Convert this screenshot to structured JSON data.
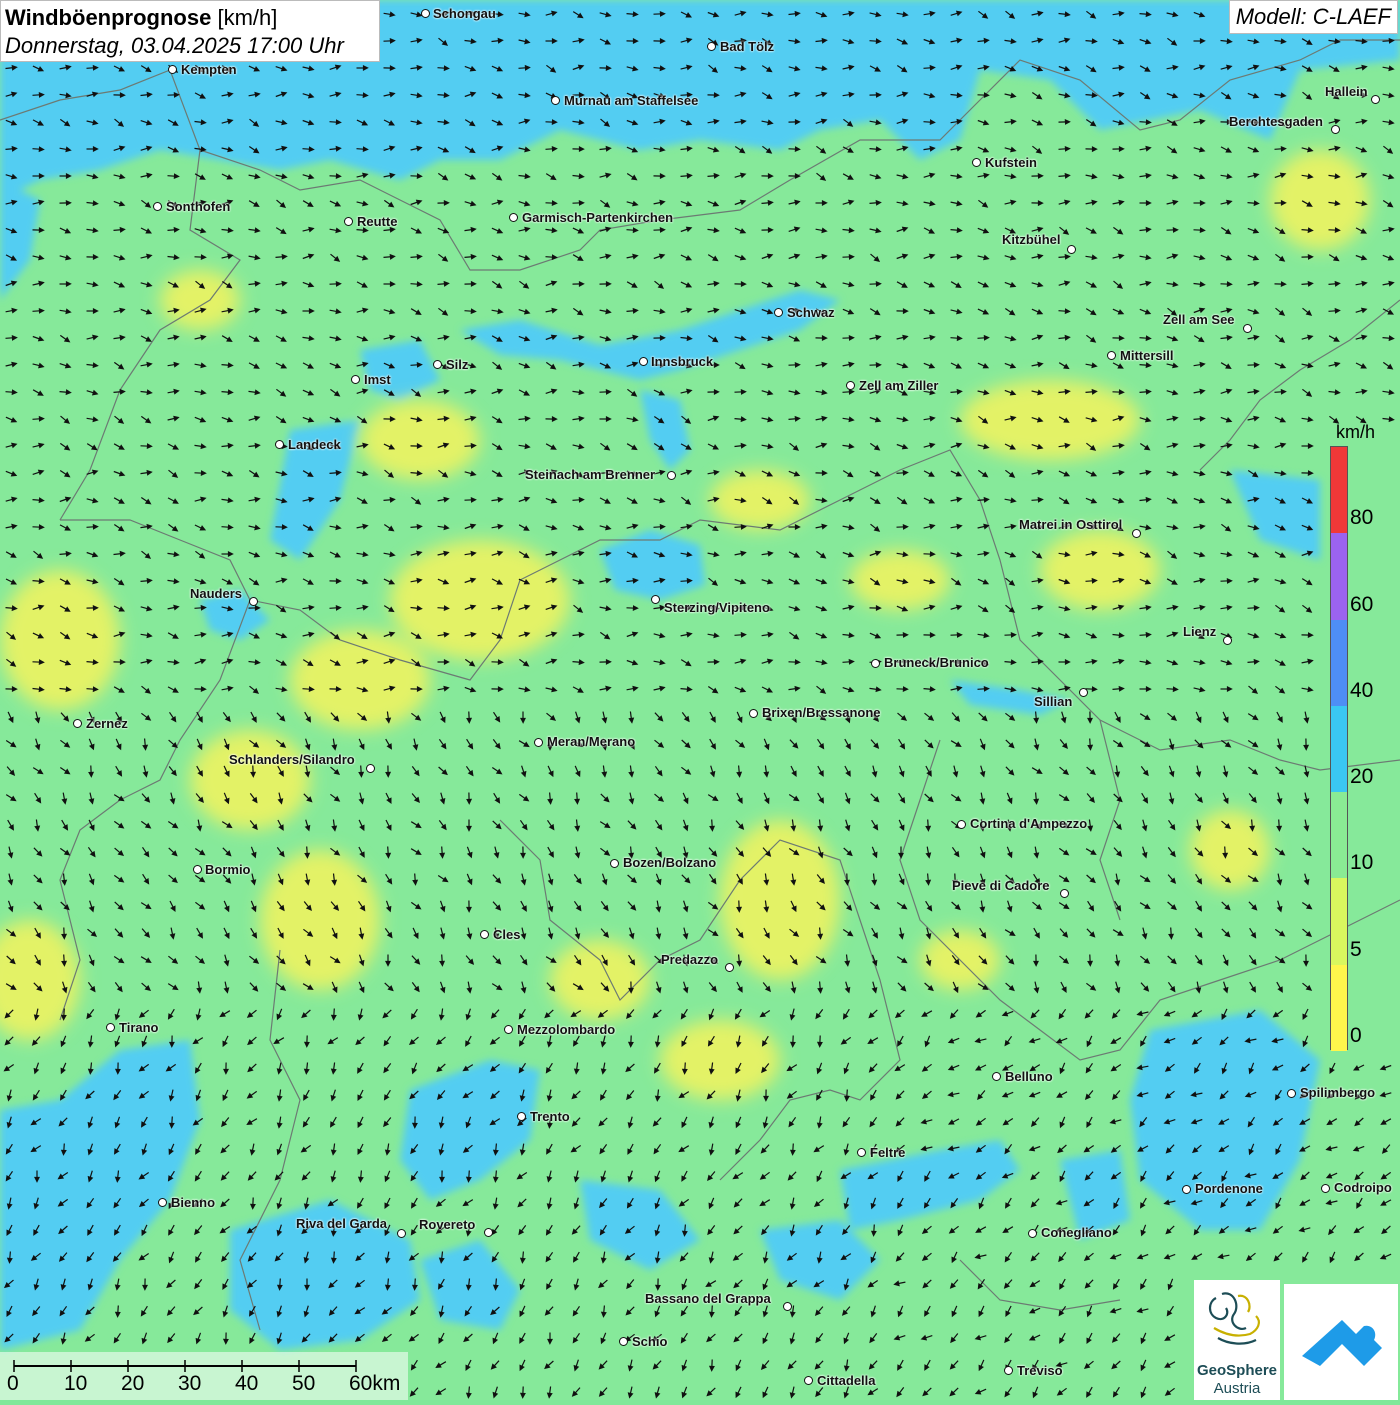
{
  "title": {
    "main": "Windböenprognose",
    "unit": "[km/h]",
    "datetime": "Donnerstag, 03.04.2025 17:00 Uhr"
  },
  "model": "Modell: C-LAEF",
  "legend": {
    "unit": "km/h",
    "ticks": [
      "0",
      "5",
      "10",
      "20",
      "40",
      "60",
      "80"
    ],
    "colors": [
      "#fff64c",
      "#d9f75e",
      "#8aeb94",
      "#3ac7f2",
      "#4e8ef5",
      "#9b63ef",
      "#f03838"
    ]
  },
  "scale": {
    "labels": [
      "0",
      "10",
      "20",
      "30",
      "40",
      "50",
      "60km"
    ]
  },
  "logos": {
    "geosphere_line1": "GeoSphere",
    "geosphere_line2": "Austria"
  },
  "cities": [
    {
      "name": "Schongau"
    },
    {
      "name": "Bad Tölz"
    },
    {
      "name": "Kempten"
    },
    {
      "name": "Murnau am Staffelsee"
    },
    {
      "name": "Hallein"
    },
    {
      "name": "Berchtesgaden"
    },
    {
      "name": "Kufstein"
    },
    {
      "name": "Sonthofen"
    },
    {
      "name": "Reutte"
    },
    {
      "name": "Garmisch-Partenkirchen"
    },
    {
      "name": "Kitzbühel"
    },
    {
      "name": "Schwaz"
    },
    {
      "name": "Zell am See"
    },
    {
      "name": "Mittersill"
    },
    {
      "name": "Innsbruck"
    },
    {
      "name": "Imst"
    },
    {
      "name": "Silz"
    },
    {
      "name": "Zell am Ziller"
    },
    {
      "name": "Landeck"
    },
    {
      "name": "Steinach am Brenner"
    },
    {
      "name": "Matrei in Osttirol"
    },
    {
      "name": "Nauders"
    },
    {
      "name": "Sterzing/Vipiteno"
    },
    {
      "name": "Lienz"
    },
    {
      "name": "Bruneck/Brunico"
    },
    {
      "name": "Sillian"
    },
    {
      "name": "Brixen/Bressanone"
    },
    {
      "name": "Zernez"
    },
    {
      "name": "Meran/Merano"
    },
    {
      "name": "Schlanders/Silandro"
    },
    {
      "name": "Cortina d'Ampezzo"
    },
    {
      "name": "Bozen/Bolzano"
    },
    {
      "name": "Bormio"
    },
    {
      "name": "Pieve di Cadore"
    },
    {
      "name": "Cles"
    },
    {
      "name": "Predazzo"
    },
    {
      "name": "Tirano"
    },
    {
      "name": "Mezzolombardo"
    },
    {
      "name": "Belluno"
    },
    {
      "name": "Spilimbergo"
    },
    {
      "name": "Trento"
    },
    {
      "name": "Feltre"
    },
    {
      "name": "Pordenone"
    },
    {
      "name": "Codroipo"
    },
    {
      "name": "Bienno"
    },
    {
      "name": "Riva del Garda"
    },
    {
      "name": "Rovereto"
    },
    {
      "name": "Conegliano"
    },
    {
      "name": "Bassano del Grappa"
    },
    {
      "name": "Schio"
    },
    {
      "name": "Treviso"
    },
    {
      "name": "Cittadella"
    }
  ]
}
